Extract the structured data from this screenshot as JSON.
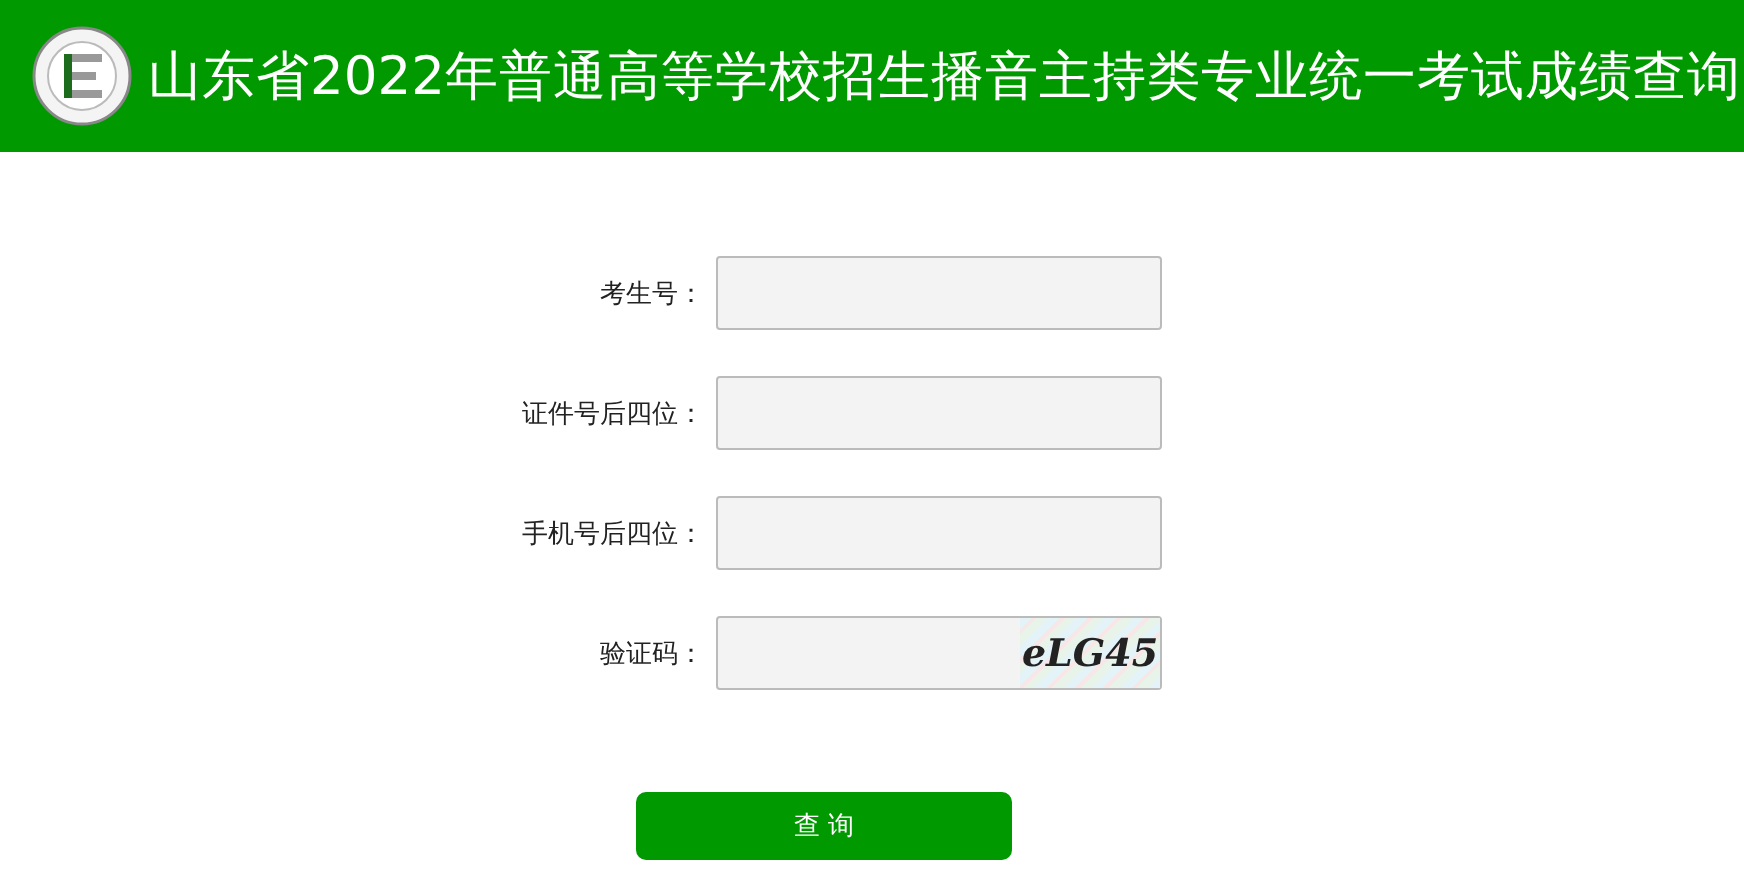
{
  "header": {
    "title": "山东省2022年普通高等学校招生播音主持类专业统一考试成绩查询"
  },
  "fields": [
    {
      "label": "考生号：",
      "kind": "text"
    },
    {
      "label": "证件号后四位：",
      "kind": "text"
    },
    {
      "label": "手机号后四位：",
      "kind": "text"
    },
    {
      "label": "验证码：",
      "kind": "captcha",
      "captcha": "eLG45"
    }
  ],
  "submit": {
    "label": "查 询"
  }
}
